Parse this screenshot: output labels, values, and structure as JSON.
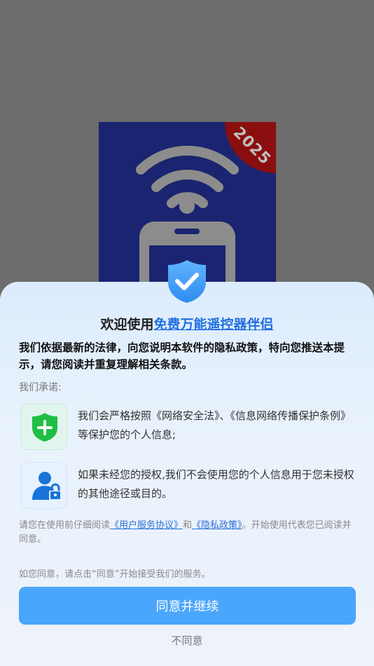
{
  "app_icon": {
    "year_badge": "2025",
    "colors": {
      "background": "#1a2470",
      "badge": "#8b0e0e",
      "glyph": "#8c8c8c"
    }
  },
  "dialog": {
    "title_prefix": "欢迎使用",
    "app_name": "免费万能遥控器伴侣",
    "lead": "我们依据最新的法律，向您说明本软件的隐私政策，特向您推送本提示，请您阅读并重复理解相关条款。",
    "promise_heading": "我们承诺:",
    "promises": [
      {
        "icon": "shield-plus-icon",
        "text": "我们会严格按照《网络安全法》、《信息网络传播保护条例》等保护您的个人信息;"
      },
      {
        "icon": "user-lock-icon",
        "text": "如果未经您的授权,我们不会使用您的个人信息用于您未授权的其他途径或目的。"
      }
    ],
    "notice": {
      "prefix": "请您在使用前仔细阅读",
      "user_agreement": "《用户服务协议》",
      "conjunction": "和",
      "privacy_policy": "《隐私政策》",
      "suffix": "。开始使用代表您已阅读并同意。"
    },
    "consent_hint": "如您同意，请点击“同意”开始接受我们的服务。",
    "agree_label": "同意并继续",
    "disagree_label": "不同意",
    "colors": {
      "accent": "#4aa6fb",
      "link": "#1f6fe0",
      "shield_green": "#1fbf45",
      "user_blue": "#1a73d9"
    }
  }
}
